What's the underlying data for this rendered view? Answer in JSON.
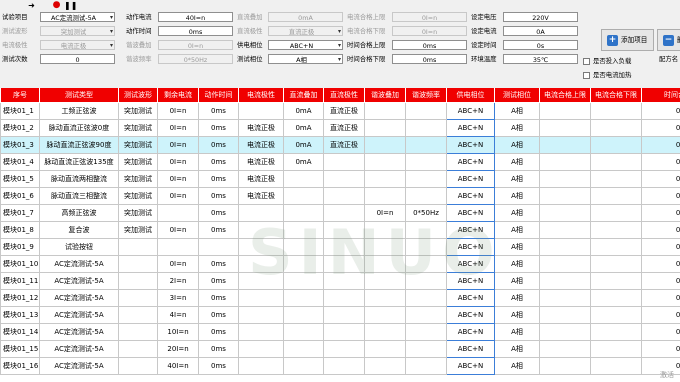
{
  "toolbar": {
    "icons": [
      "arrow-right-icon",
      "record-icon",
      "pause-icon"
    ]
  },
  "form": {
    "col1": [
      {
        "label": "试验项目",
        "value": "AC定流测试-5A",
        "enabled": true,
        "select": true
      },
      {
        "label": "测试波形",
        "value": "突加测试",
        "enabled": false,
        "select": true
      },
      {
        "label": "电流极性",
        "value": "电流正极",
        "enabled": false,
        "select": true
      },
      {
        "label": "测试次数",
        "value": "0",
        "enabled": true,
        "select": false
      }
    ],
    "col2": [
      {
        "label": "动作电流",
        "value": "40I=n",
        "enabled": true,
        "select": false
      },
      {
        "label": "动作时间",
        "value": "0ms",
        "enabled": true,
        "select": false
      },
      {
        "label": "谐波叠加",
        "value": "0I=n",
        "enabled": false,
        "select": false
      },
      {
        "label": "谐波频率",
        "value": "0*50Hz",
        "enabled": false,
        "select": false
      }
    ],
    "col3": [
      {
        "label": "直流叠加",
        "value": "0mA",
        "enabled": false,
        "select": false
      },
      {
        "label": "直流极性",
        "value": "直流正极",
        "enabled": false,
        "select": true
      },
      {
        "label": "供电相位",
        "value": "ABC+N",
        "enabled": true,
        "select": true
      },
      {
        "label": "测试相位",
        "value": "A相",
        "enabled": true,
        "select": true
      }
    ],
    "col4": [
      {
        "label": "电流合格上限",
        "value": "0I=n",
        "enabled": false,
        "select": false
      },
      {
        "label": "电流合格下限",
        "value": "0I=n",
        "enabled": false,
        "select": false
      },
      {
        "label": "时间合格上限",
        "value": "0ms",
        "enabled": true,
        "select": false
      },
      {
        "label": "时间合格下限",
        "value": "0ms",
        "enabled": true,
        "select": false
      }
    ],
    "col5": [
      {
        "label": "设定电压",
        "value": "220V"
      },
      {
        "label": "设定电流",
        "value": "0A"
      },
      {
        "label": "设定时间",
        "value": "0s"
      },
      {
        "label": "环境温度",
        "value": "35℃"
      }
    ],
    "checks": [
      "是否投入负载",
      "是否电流加热"
    ],
    "add_button": "添加项目",
    "del_button": "删",
    "formula_label": "配方名"
  },
  "table": {
    "headers": [
      "序号",
      "测试类型",
      "测试波形",
      "剩余电流",
      "动作时间",
      "电流极性",
      "直流叠加",
      "直流极性",
      "谐波叠加",
      "谐波频率",
      "供电相位",
      "测试相位",
      "电流合格上限",
      "电流合格下限",
      "时间合格上"
    ],
    "rows": [
      [
        "模块01_1",
        "工频正弦波",
        "突加测试",
        "0I=n",
        "0ms",
        "",
        "0mA",
        "直流正极",
        "",
        "",
        "ABC+N",
        "A相",
        "",
        "",
        "0m"
      ],
      [
        "模块01_2",
        "脉动直流正弦波0度",
        "突加测试",
        "0I=n",
        "0ms",
        "电流正极",
        "0mA",
        "直流正极",
        "",
        "",
        "ABC+N",
        "A相",
        "",
        "",
        "0m"
      ],
      [
        "模块01_3",
        "脉动直流正弦波90度",
        "突加测试",
        "0I=n",
        "0ms",
        "电流正极",
        "0mA",
        "直流正极",
        "",
        "",
        "ABC+N",
        "A相",
        "",
        "",
        "0m"
      ],
      [
        "模块01_4",
        "脉动直流正弦波135度",
        "突加测试",
        "0I=n",
        "0ms",
        "电流正极",
        "0mA",
        "",
        "",
        "",
        "ABC+N",
        "A相",
        "",
        "",
        "0m"
      ],
      [
        "模块01_5",
        "脉动直流两相整流",
        "突加测试",
        "0I=n",
        "0ms",
        "电流正极",
        "",
        "",
        "",
        "",
        "ABC+N",
        "A相",
        "",
        "",
        "0m"
      ],
      [
        "模块01_6",
        "脉动直流三相整流",
        "突加测试",
        "0I=n",
        "0ms",
        "电流正极",
        "",
        "",
        "",
        "",
        "ABC+N",
        "A相",
        "",
        "",
        "0m"
      ],
      [
        "模块01_7",
        "高频正弦波",
        "突加测试",
        "",
        "0ms",
        "",
        "",
        "",
        "0I=n",
        "0*50Hz",
        "ABC+N",
        "A相",
        "",
        "",
        "0m"
      ],
      [
        "模块01_8",
        "复合波",
        "突加测试",
        "0I=n",
        "0ms",
        "",
        "",
        "",
        "",
        "",
        "ABC+N",
        "A相",
        "",
        "",
        "0m"
      ],
      [
        "模块01_9",
        "试验按钮",
        "",
        "",
        "",
        "",
        "",
        "",
        "",
        "",
        "ABC+N",
        "A相",
        "",
        "",
        "0m"
      ],
      [
        "模块01_10",
        "AC定流测试-5A",
        "",
        "0I=n",
        "0ms",
        "",
        "",
        "",
        "",
        "",
        "ABC+N",
        "A相",
        "",
        "",
        "0m"
      ],
      [
        "模块01_11",
        "AC定流测试-5A",
        "",
        "2I=n",
        "0ms",
        "",
        "",
        "",
        "",
        "",
        "ABC+N",
        "A相",
        "",
        "",
        "0m"
      ],
      [
        "模块01_12",
        "AC定流测试-5A",
        "",
        "3I=n",
        "0ms",
        "",
        "",
        "",
        "",
        "",
        "ABC+N",
        "A相",
        "",
        "",
        "0m"
      ],
      [
        "模块01_13",
        "AC定流测试-5A",
        "",
        "4I=n",
        "0ms",
        "",
        "",
        "",
        "",
        "",
        "ABC+N",
        "A相",
        "",
        "",
        "0m"
      ],
      [
        "模块01_14",
        "AC定流测试-5A",
        "",
        "10I=n",
        "0ms",
        "",
        "",
        "",
        "",
        "",
        "ABC+N",
        "A相",
        "",
        "",
        "0m"
      ],
      [
        "模块01_15",
        "AC定流测试-5A",
        "",
        "20I=n",
        "0ms",
        "",
        "",
        "",
        "",
        "",
        "ABC+N",
        "A相",
        "",
        "",
        "0m"
      ],
      [
        "模块01_16",
        "AC定流测试-5A",
        "",
        "40I=n",
        "0ms",
        "",
        "",
        "",
        "",
        "",
        "ABC+N",
        "A相",
        "",
        "",
        "0m"
      ]
    ],
    "highlight_row": 2
  },
  "watermark": "SINUO",
  "watermark_small": "激活"
}
